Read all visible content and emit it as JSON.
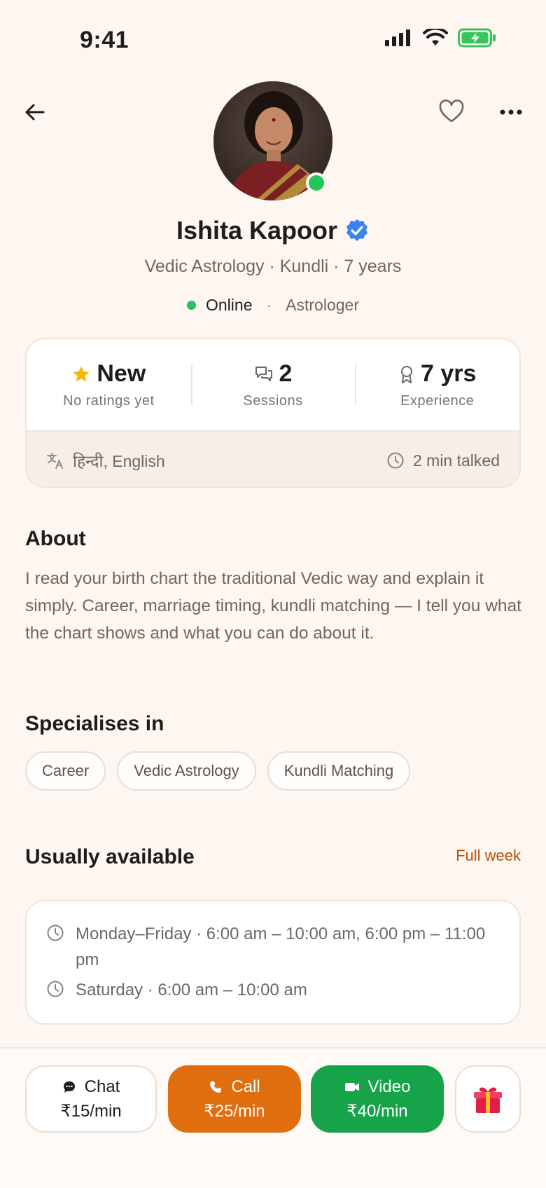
{
  "status_bar": {
    "time": "9:41"
  },
  "profile": {
    "name": "Ishita Kapoor",
    "subtitle": "Vedic Astrology · Kundli · 7 years",
    "online_label": "Online",
    "separator": "·",
    "role": "Astrologer"
  },
  "stats": {
    "rating_main": "New",
    "rating_sub": "No ratings yet",
    "sessions_main": "2",
    "sessions_sub": "Sessions",
    "experience_main": "7 yrs",
    "experience_sub": "Experience",
    "languages": "हिन्दी, English",
    "talked": "2 min talked"
  },
  "about": {
    "title": "About",
    "text": "I read your birth chart the traditional Vedic way and explain it simply. Career, marriage timing, kundli matching — I tell you what the chart shows and what you can do about it."
  },
  "specialises": {
    "title": "Specialises in",
    "chips": [
      "Career",
      "Vedic Astrology",
      "Kundli Matching"
    ]
  },
  "availability": {
    "title": "Usually available",
    "link": "Full week",
    "rows": [
      "Monday–Friday · 6:00 am – 10:00 am, 6:00 pm – 11:00 pm",
      "Saturday · 6:00 am – 10:00 am"
    ]
  },
  "actions": {
    "chat": {
      "label": "Chat",
      "price": "₹15/min"
    },
    "call": {
      "label": "Call",
      "price": "₹25/min"
    },
    "video": {
      "label": "Video",
      "price": "₹40/min"
    }
  },
  "colors": {
    "background": "#fdf6f1",
    "online": "#22c55e",
    "call": "#e06e0e",
    "video": "#16a34a",
    "verified": "#3b82f6",
    "link": "#b45309",
    "star": "#f5b800"
  },
  "icons": [
    "back-arrow-icon",
    "heart-icon",
    "more-icon",
    "verified-icon",
    "star-icon",
    "chat-bubbles-icon",
    "award-icon",
    "translate-icon",
    "clock-icon",
    "chat-icon",
    "phone-icon",
    "video-icon",
    "gift-icon"
  ]
}
